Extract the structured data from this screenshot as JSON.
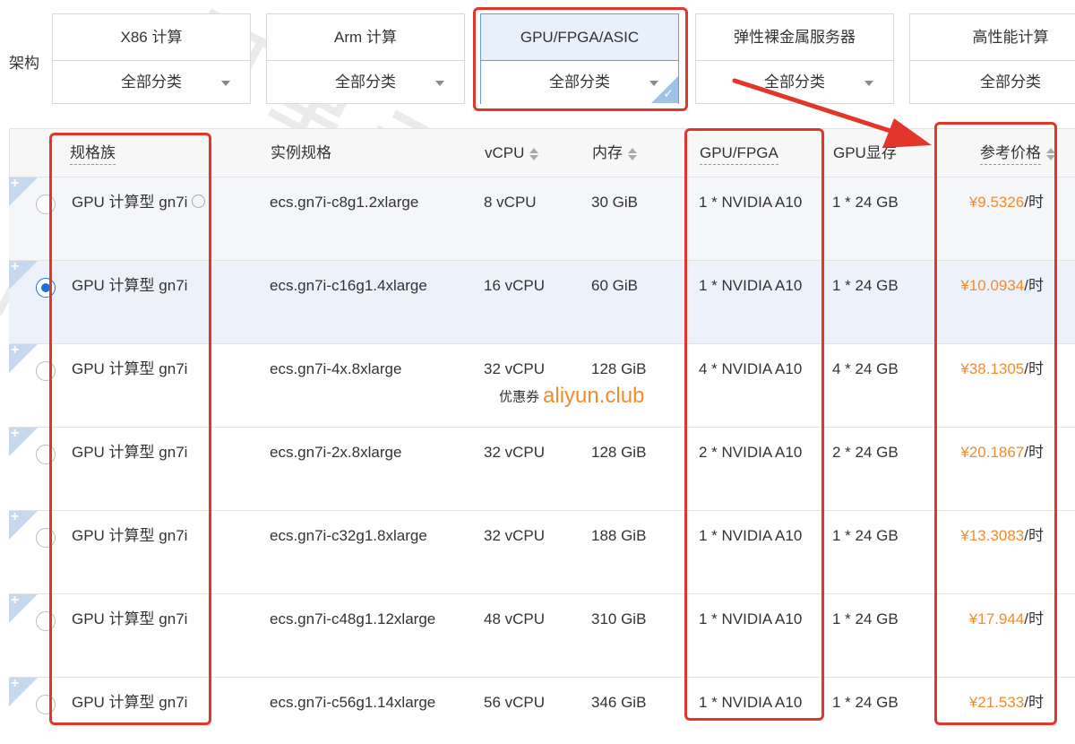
{
  "filter": {
    "label": "架构",
    "cards": [
      {
        "title": "X86 计算",
        "select": "全部分类",
        "active": false
      },
      {
        "title": "Arm 计算",
        "select": "全部分类",
        "active": false
      },
      {
        "title": "GPU/FPGA/ASIC",
        "select": "全部分类",
        "active": true
      },
      {
        "title": "弹性裸金属服务器",
        "select": "全部分类",
        "active": false
      },
      {
        "title": "高性能计算",
        "select": "全部分类",
        "active": false
      }
    ]
  },
  "table": {
    "columns": {
      "family": "规格族",
      "spec": "实例规格",
      "vcpu": "vCPU",
      "memory": "内存",
      "gpu": "GPU/FPGA",
      "gpu_mem": "GPU显存",
      "price": "参考价格"
    },
    "rows": [
      {
        "family": "GPU 计算型 gn7i",
        "spec": "ecs.gn7i-c8g1.2xlarge",
        "vcpu": "8 vCPU",
        "memory": "30 GiB",
        "gpu": "1 * NVIDIA A10",
        "gpu_mem": "1 * 24 GB",
        "price": "¥9.5326",
        "unit": "/时",
        "selected": false
      },
      {
        "family": "GPU 计算型 gn7i",
        "spec": "ecs.gn7i-c16g1.4xlarge",
        "vcpu": "16 vCPU",
        "memory": "60 GiB",
        "gpu": "1 * NVIDIA A10",
        "gpu_mem": "1 * 24 GB",
        "price": "¥10.0934",
        "unit": "/时",
        "selected": true
      },
      {
        "family": "GPU 计算型 gn7i",
        "spec": "ecs.gn7i-4x.8xlarge",
        "vcpu": "32 vCPU",
        "memory": "128 GiB",
        "gpu": "4 * NVIDIA A10",
        "gpu_mem": "4 * 24 GB",
        "price": "¥38.1305",
        "unit": "/时",
        "selected": false
      },
      {
        "family": "GPU 计算型 gn7i",
        "spec": "ecs.gn7i-2x.8xlarge",
        "vcpu": "32 vCPU",
        "memory": "128 GiB",
        "gpu": "2 * NVIDIA A10",
        "gpu_mem": "2 * 24 GB",
        "price": "¥20.1867",
        "unit": "/时",
        "selected": false
      },
      {
        "family": "GPU 计算型 gn7i",
        "spec": "ecs.gn7i-c32g1.8xlarge",
        "vcpu": "32 vCPU",
        "memory": "188 GiB",
        "gpu": "1 * NVIDIA A10",
        "gpu_mem": "1 * 24 GB",
        "price": "¥13.3083",
        "unit": "/时",
        "selected": false
      },
      {
        "family": "GPU 计算型 gn7i",
        "spec": "ecs.gn7i-c48g1.12xlarge",
        "vcpu": "48 vCPU",
        "memory": "310 GiB",
        "gpu": "1 * NVIDIA A10",
        "gpu_mem": "1 * 24 GB",
        "price": "¥17.944",
        "unit": "/时",
        "selected": false
      },
      {
        "family": "GPU 计算型 gn7i",
        "spec": "ecs.gn7i-c56g1.14xlarge",
        "vcpu": "56 vCPU",
        "memory": "346 GiB",
        "gpu": "1 * NVIDIA A10",
        "gpu_mem": "1 * 24 GB",
        "price": "¥21.533",
        "unit": "/时",
        "selected": false
      }
    ]
  },
  "coupon": {
    "label": "优惠券",
    "site": "aliyun.club"
  },
  "watermark": {
    "cn": "阿里云百科",
    "en": "aliyunbaike.com"
  },
  "colors": {
    "price": "#f08c2e",
    "highlight": "#e3362b",
    "active_card": "#e7f0fb",
    "radio_checked": "#1f6fd6"
  }
}
